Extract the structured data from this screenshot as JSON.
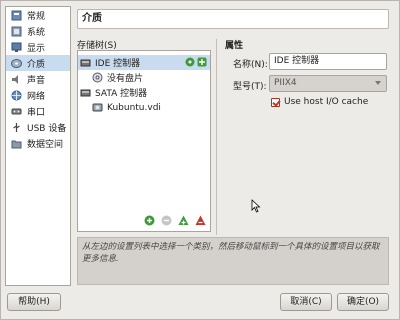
{
  "sidebar": {
    "items": [
      {
        "label": "常规",
        "icon": "general-icon"
      },
      {
        "label": "系统",
        "icon": "system-icon"
      },
      {
        "label": "显示",
        "icon": "display-icon"
      },
      {
        "label": "介质",
        "icon": "storage-icon"
      },
      {
        "label": "声音",
        "icon": "audio-icon"
      },
      {
        "label": "网络",
        "icon": "network-icon"
      },
      {
        "label": "串口",
        "icon": "serial-icon"
      },
      {
        "label": "USB 设备",
        "icon": "usb-icon"
      },
      {
        "label": "数据空间",
        "icon": "shared-folder-icon"
      }
    ],
    "selected": "介质"
  },
  "header": {
    "title": "介质"
  },
  "storage": {
    "tree_label": "存储树(S)",
    "nodes": [
      {
        "label": "IDE 控制器"
      },
      {
        "label": "没有盘片"
      },
      {
        "label": "SATA 控制器"
      },
      {
        "label": "Kubuntu.vdi"
      }
    ]
  },
  "attributes": {
    "heading": "属性",
    "name_label": "名称(N):",
    "name_value": "IDE 控制器",
    "type_label": "型号(T):",
    "type_value": "PIIX4",
    "host_cache_label": "Use host I/O cache"
  },
  "info": {
    "text": "从左边的设置列表中选择一个类别，然后移动鼠标到一个具体的设置项目以获取更多信息."
  },
  "buttons": {
    "help": "帮助(H)",
    "cancel": "取消(C)",
    "ok": "确定(O)"
  },
  "colors": {
    "selection": "#c9dbee",
    "add_green": "#3f9b3a",
    "remove_red": "#c0392b"
  }
}
